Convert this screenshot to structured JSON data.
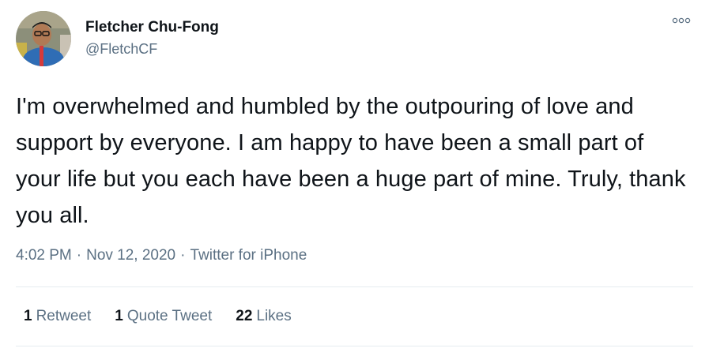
{
  "user": {
    "display_name": "Fletcher Chu-Fong",
    "handle": "@FletchCF",
    "avatar": "profile-photo"
  },
  "menu_icon": "more-options-icon",
  "tweet": {
    "text": "I'm overwhelmed and humbled by the outpouring of love and support by everyone. I am happy to have been a small part of your life but you each have been a huge part of mine. Truly, thank you all.",
    "time": "4:02 PM",
    "date": "Nov 12, 2020",
    "source": "Twitter for iPhone",
    "separator": "·"
  },
  "stats": {
    "retweets_count": "1",
    "retweets_label": "Retweet",
    "quotes_count": "1",
    "quotes_label": "Quote Tweet",
    "likes_count": "22",
    "likes_label": "Likes"
  },
  "colors": {
    "text": "#0f1419",
    "secondary": "#5b7083",
    "divider": "#e6ecf0"
  }
}
